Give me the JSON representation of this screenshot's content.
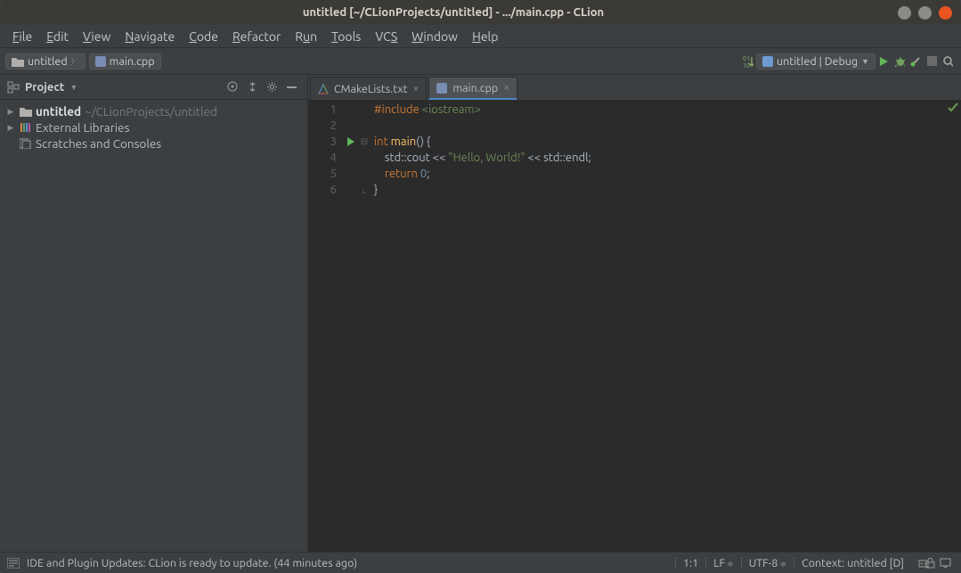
{
  "titlebar": {
    "title": "untitled [~/CLionProjects/untitled] - .../main.cpp - CLion"
  },
  "menu": [
    "File",
    "Edit",
    "View",
    "Navigate",
    "Code",
    "Refactor",
    "Run",
    "Tools",
    "VCS",
    "Window",
    "Help"
  ],
  "breadcrumb": {
    "project": "untitled",
    "file": "main.cpp"
  },
  "runconfig": {
    "label": "untitled | Debug"
  },
  "project_panel": {
    "title": "Project",
    "root": {
      "name": "untitled",
      "path": "~/CLionProjects/untitled"
    },
    "ext_libs": "External Libraries",
    "scratch": "Scratches and Consoles"
  },
  "tabs": [
    {
      "label": "CMakeLists.txt",
      "active": false
    },
    {
      "label": "main.cpp",
      "active": true
    }
  ],
  "code": {
    "lines": [
      "1",
      "2",
      "3",
      "4",
      "5",
      "6"
    ],
    "include_kw": "#include",
    "include_arg": " <iostream>",
    "int_kw": "int ",
    "main_fn": "main",
    "main_rest": "() {",
    "cout_line_pre": "    std::cout << ",
    "hello_str": "\"Hello, World!\"",
    "cout_line_post": " << std::endl;",
    "return_indent": "    ",
    "return_kw": "return ",
    "return_val": "0",
    "semicolon": ";",
    "closebrace": "}"
  },
  "status": {
    "msg": "IDE and Plugin Updates: CLion is ready to update. (44 minutes ago)",
    "pos": "1:1",
    "lineend": "LF",
    "encoding": "UTF-8",
    "context": "Context: untitled [D]"
  }
}
